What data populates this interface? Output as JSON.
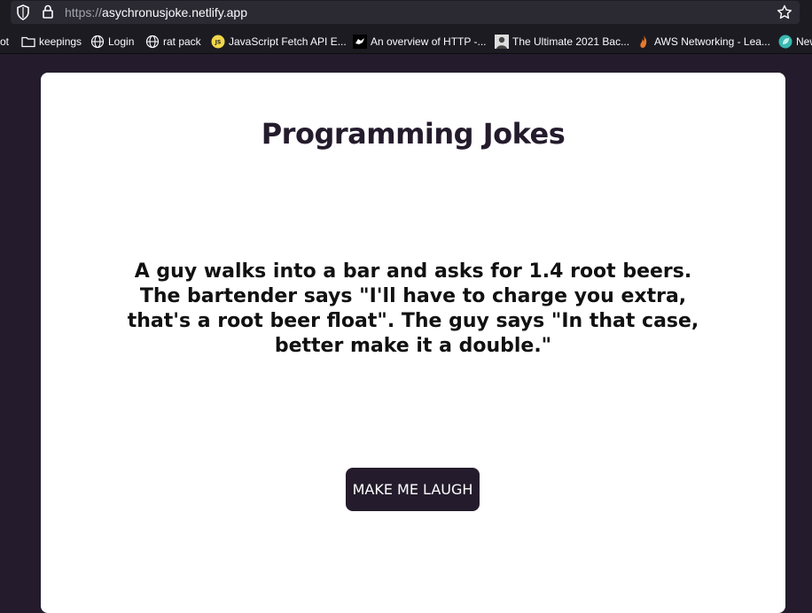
{
  "browser": {
    "url_scheme": "https://",
    "url_host": "asychronusjoke.netlify.app",
    "bookmarks": [
      {
        "label": "ot",
        "icon": "truncated-item"
      },
      {
        "label": "keepings",
        "icon": "folder-icon"
      },
      {
        "label": "Login",
        "icon": "globe-icon"
      },
      {
        "label": "rat pack",
        "icon": "globe-icon"
      },
      {
        "label": "JavaScript Fetch API E...",
        "icon": "js-icon"
      },
      {
        "label": "An overview of HTTP -...",
        "icon": "mdn-icon"
      },
      {
        "label": "The Ultimate 2021 Bac...",
        "icon": "portrait-icon"
      },
      {
        "label": "AWS Networking - Lea...",
        "icon": "fire-icon"
      },
      {
        "label": "New",
        "icon": "leaf-icon"
      }
    ]
  },
  "page": {
    "title": "Programming Jokes",
    "joke": "A guy walks into a bar and asks for 1.4 root beers. The bartender says \"I'll have to charge you extra, that's a root beer float\". The guy says \"In that case, better make it a double.\"",
    "button_label": "MAKE ME LAUGH"
  },
  "colors": {
    "page_background": "#241c2c",
    "card_background": "#ffffff",
    "button_background": "#241c2c",
    "title_color": "#241c2c"
  }
}
